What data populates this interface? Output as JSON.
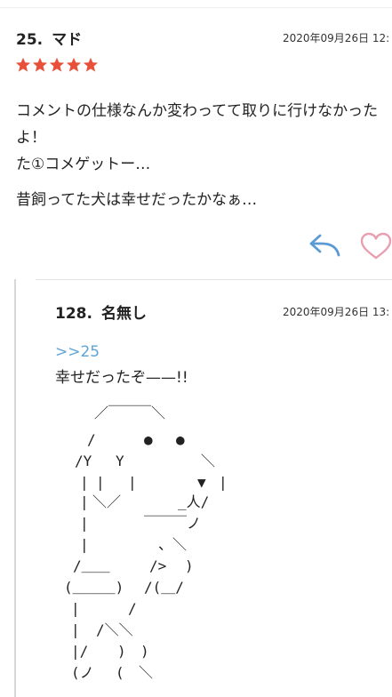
{
  "comment": {
    "number": "25.",
    "name": "マド",
    "date": "2020年09月26日 12:",
    "rating": 5,
    "body": "コメントの仕様なんか変わってて取りに行けなかったよ！\nた①コメゲットー…",
    "line2": "昔飼ってた犬は幸せだったかなぁ…",
    "colors": {
      "star": "#e8503a",
      "reply": "#5b9bd5",
      "heart": "#e8a0b0"
    },
    "icons": [
      "reply-icon",
      "heart-icon"
    ]
  },
  "reply": {
    "number": "128.",
    "name": "名無し",
    "date": "2020年09月26日 13:",
    "anchor": ">>25",
    "text": "幸せだったぞ——!!",
    "art": [
      "／￣￣￣＼",
      "/",
      "●",
      "●",
      "/Y",
      "Y",
      "＼",
      "|",
      "|",
      "|",
      "▼",
      "|",
      "|",
      "＼／",
      "_人/",
      "|",
      "￣￣￣ノ",
      "|",
      "、＼",
      "/＿＿",
      "/>",
      ")",
      "(＿＿＿)",
      "/(＿/",
      "|",
      "/",
      "|",
      "/＼＼",
      "|/",
      ")",
      ")",
      "(ノ",
      "(",
      "＼"
    ]
  }
}
